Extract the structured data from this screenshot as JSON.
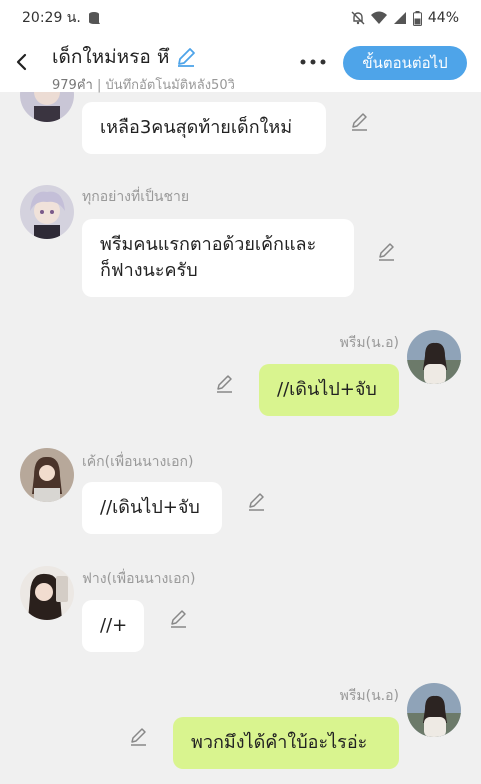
{
  "status_bar": {
    "time": "20:29 น.",
    "battery": "44%"
  },
  "header": {
    "title": "เด็กใหม่หรอ หึ",
    "count": "979คำ",
    "subtitle_rest": " | บันทึกอัตโนมัติหลัง50วิ",
    "next_label": "ขั้นตอนต่อไป"
  },
  "messages": [
    {
      "side": "left",
      "name": "",
      "text": "เหลือ3คนสุดท้ายเด็กใหม่",
      "avatar": "anime-character-avatar"
    },
    {
      "side": "left",
      "name": "ทุกอย่างที่เป็นชาย",
      "text": "พรีมคนแรกตาอด้วยเค้กและ\nก็ฟางนะครับ",
      "avatar": "anime-character-avatar"
    },
    {
      "side": "right",
      "name": "พรีม(น.อ)",
      "text": "//เดินไป+จับ",
      "avatar": "girl-outdoor-avatar"
    },
    {
      "side": "left",
      "name": "เค้ก(เพื่อนนางเอก)",
      "text": "//เดินไป+จับ",
      "avatar": "girl-portrait-avatar"
    },
    {
      "side": "left",
      "name": "ฟาง(เพื่อนนางเอก)",
      "text": "//+",
      "avatar": "girl-selfie-avatar"
    },
    {
      "side": "right",
      "name": "พรีม(น.อ)",
      "text": "พวกมึงได้คำใบ้อะไรอ่ะ",
      "avatar": "girl-outdoor-avatar"
    }
  ],
  "colors": {
    "accent": "#4ea4e9",
    "right_bubble": "#d9f48f",
    "left_bubble": "#ffffff",
    "background": "#f0f0f0"
  }
}
